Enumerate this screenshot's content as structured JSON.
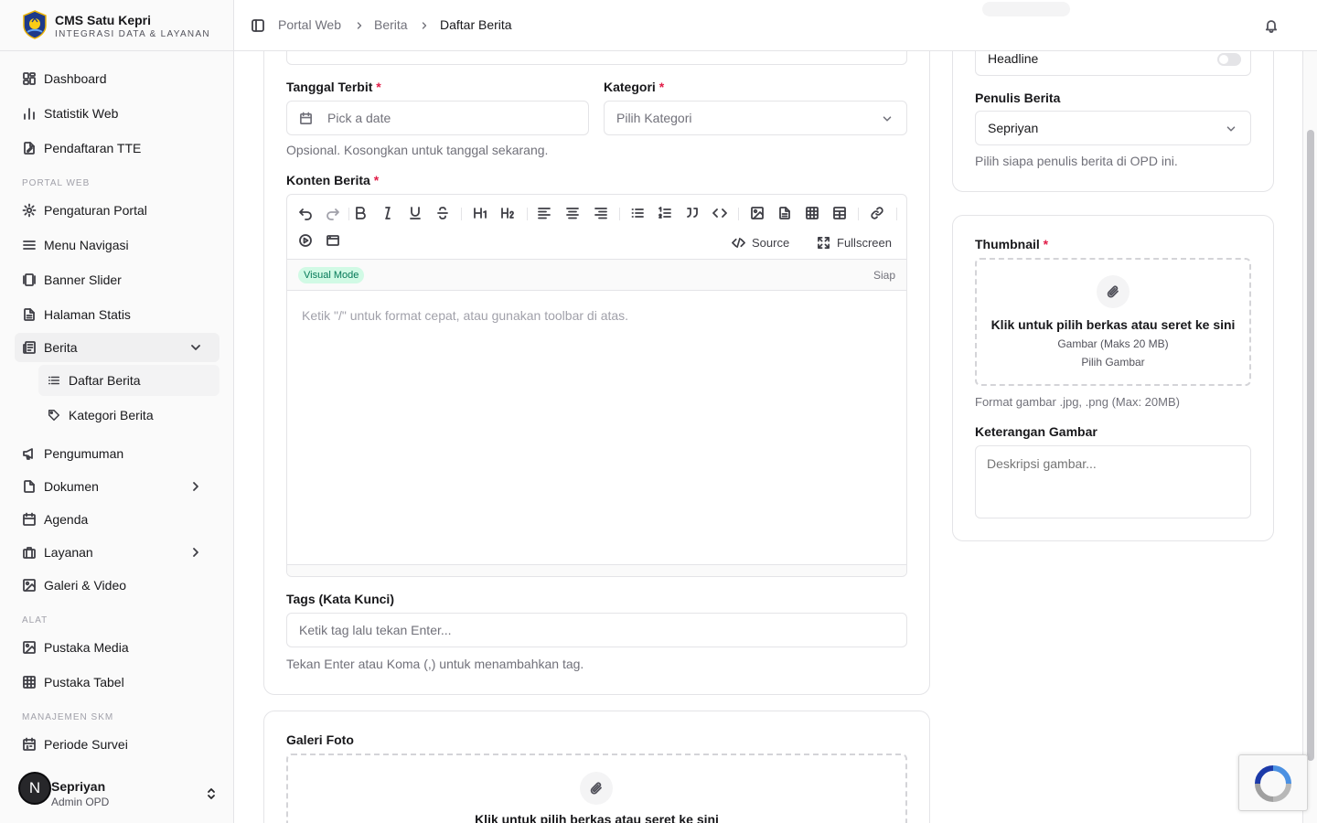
{
  "brand": {
    "title": "CMS Satu Kepri",
    "subtitle": "INTEGRASI DATA & LAYANAN"
  },
  "sidebar": {
    "items": [
      {
        "label": "Dashboard",
        "icon": "dashboard-icon"
      },
      {
        "label": "Statistik Web",
        "icon": "bar-chart-icon"
      },
      {
        "label": "Pendaftaran TTE",
        "icon": "file-signature-icon"
      }
    ],
    "portal_group": "PORTAL WEB",
    "portal_items": [
      {
        "label": "Pengaturan Portal",
        "icon": "gear-icon"
      },
      {
        "label": "Menu Navigasi",
        "icon": "menu-icon"
      },
      {
        "label": "Banner Slider",
        "icon": "gallery-icon"
      },
      {
        "label": "Halaman Statis",
        "icon": "document-icon"
      },
      {
        "label": "Berita",
        "icon": "newspaper-icon"
      }
    ],
    "berita_sub": [
      {
        "label": "Daftar Berita",
        "icon": "list-icon"
      },
      {
        "label": "Kategori Berita",
        "icon": "tag-icon"
      }
    ],
    "more_items": [
      {
        "label": "Pengumuman",
        "icon": "megaphone-icon"
      },
      {
        "label": "Dokumen",
        "icon": "folder-icon"
      },
      {
        "label": "Agenda",
        "icon": "calendar-icon"
      },
      {
        "label": "Layanan",
        "icon": "briefcase-icon"
      },
      {
        "label": "Galeri & Video",
        "icon": "image-icon"
      }
    ],
    "tools_group": "ALAT",
    "tools_items": [
      {
        "label": "Pustaka Media",
        "icon": "image-icon"
      },
      {
        "label": "Pustaka Tabel",
        "icon": "table-icon"
      }
    ],
    "skm_group": "MANAJEMEN SKM",
    "skm_items": [
      {
        "label": "Periode Survei",
        "icon": "calendar-check-icon"
      }
    ]
  },
  "user": {
    "initial": "N",
    "name": "Sepriyan",
    "role": "Admin OPD"
  },
  "breadcrumb": [
    "Portal Web",
    "Berita",
    "Daftar Berita"
  ],
  "form": {
    "tanggal_label": "Tanggal Terbit",
    "tanggal_placeholder": "Pick a date",
    "tanggal_helper": "Opsional. Kosongkan untuk tanggal sekarang.",
    "kategori_label": "Kategori",
    "kategori_placeholder": "Pilih Kategori",
    "konten_label": "Konten Berita",
    "source_label": "Source",
    "fullscreen_label": "Fullscreen",
    "mode_badge": "Visual Mode",
    "editor_status": "Siap",
    "editor_placeholder": "Ketik \"/\" untuk format cepat, atau gunakan toolbar di atas.",
    "tags_label": "Tags (Kata Kunci)",
    "tags_placeholder": "Ketik tag lalu tekan Enter...",
    "tags_helper": "Tekan Enter atau Koma (,) untuk menambahkan tag.",
    "galeri_label": "Galeri Foto",
    "galeri_drop_title": "Klik untuk pilih berkas atau seret ke sini",
    "required_mark": "*"
  },
  "side": {
    "headline_label": "Headline",
    "headline_on": false,
    "penulis_label": "Penulis Berita",
    "penulis_value": "Sepriyan",
    "penulis_helper": "Pilih siapa penulis berita di OPD ini.",
    "thumbnail_label": "Thumbnail",
    "thumb_drop_title": "Klik untuk pilih berkas atau seret ke sini",
    "thumb_drop_sub": "Gambar (Maks 20 MB)",
    "thumb_drop_pick": "Pilih Gambar",
    "thumb_helper": "Format gambar .jpg, .png (Max: 20MB)",
    "keterangan_label": "Keterangan Gambar",
    "keterangan_placeholder": "Deskripsi gambar..."
  },
  "colors": {
    "required": "#e11d48",
    "badge_bg": "#d1fae5",
    "badge_text": "#047857",
    "sidebar_bg": "#fafafa"
  }
}
